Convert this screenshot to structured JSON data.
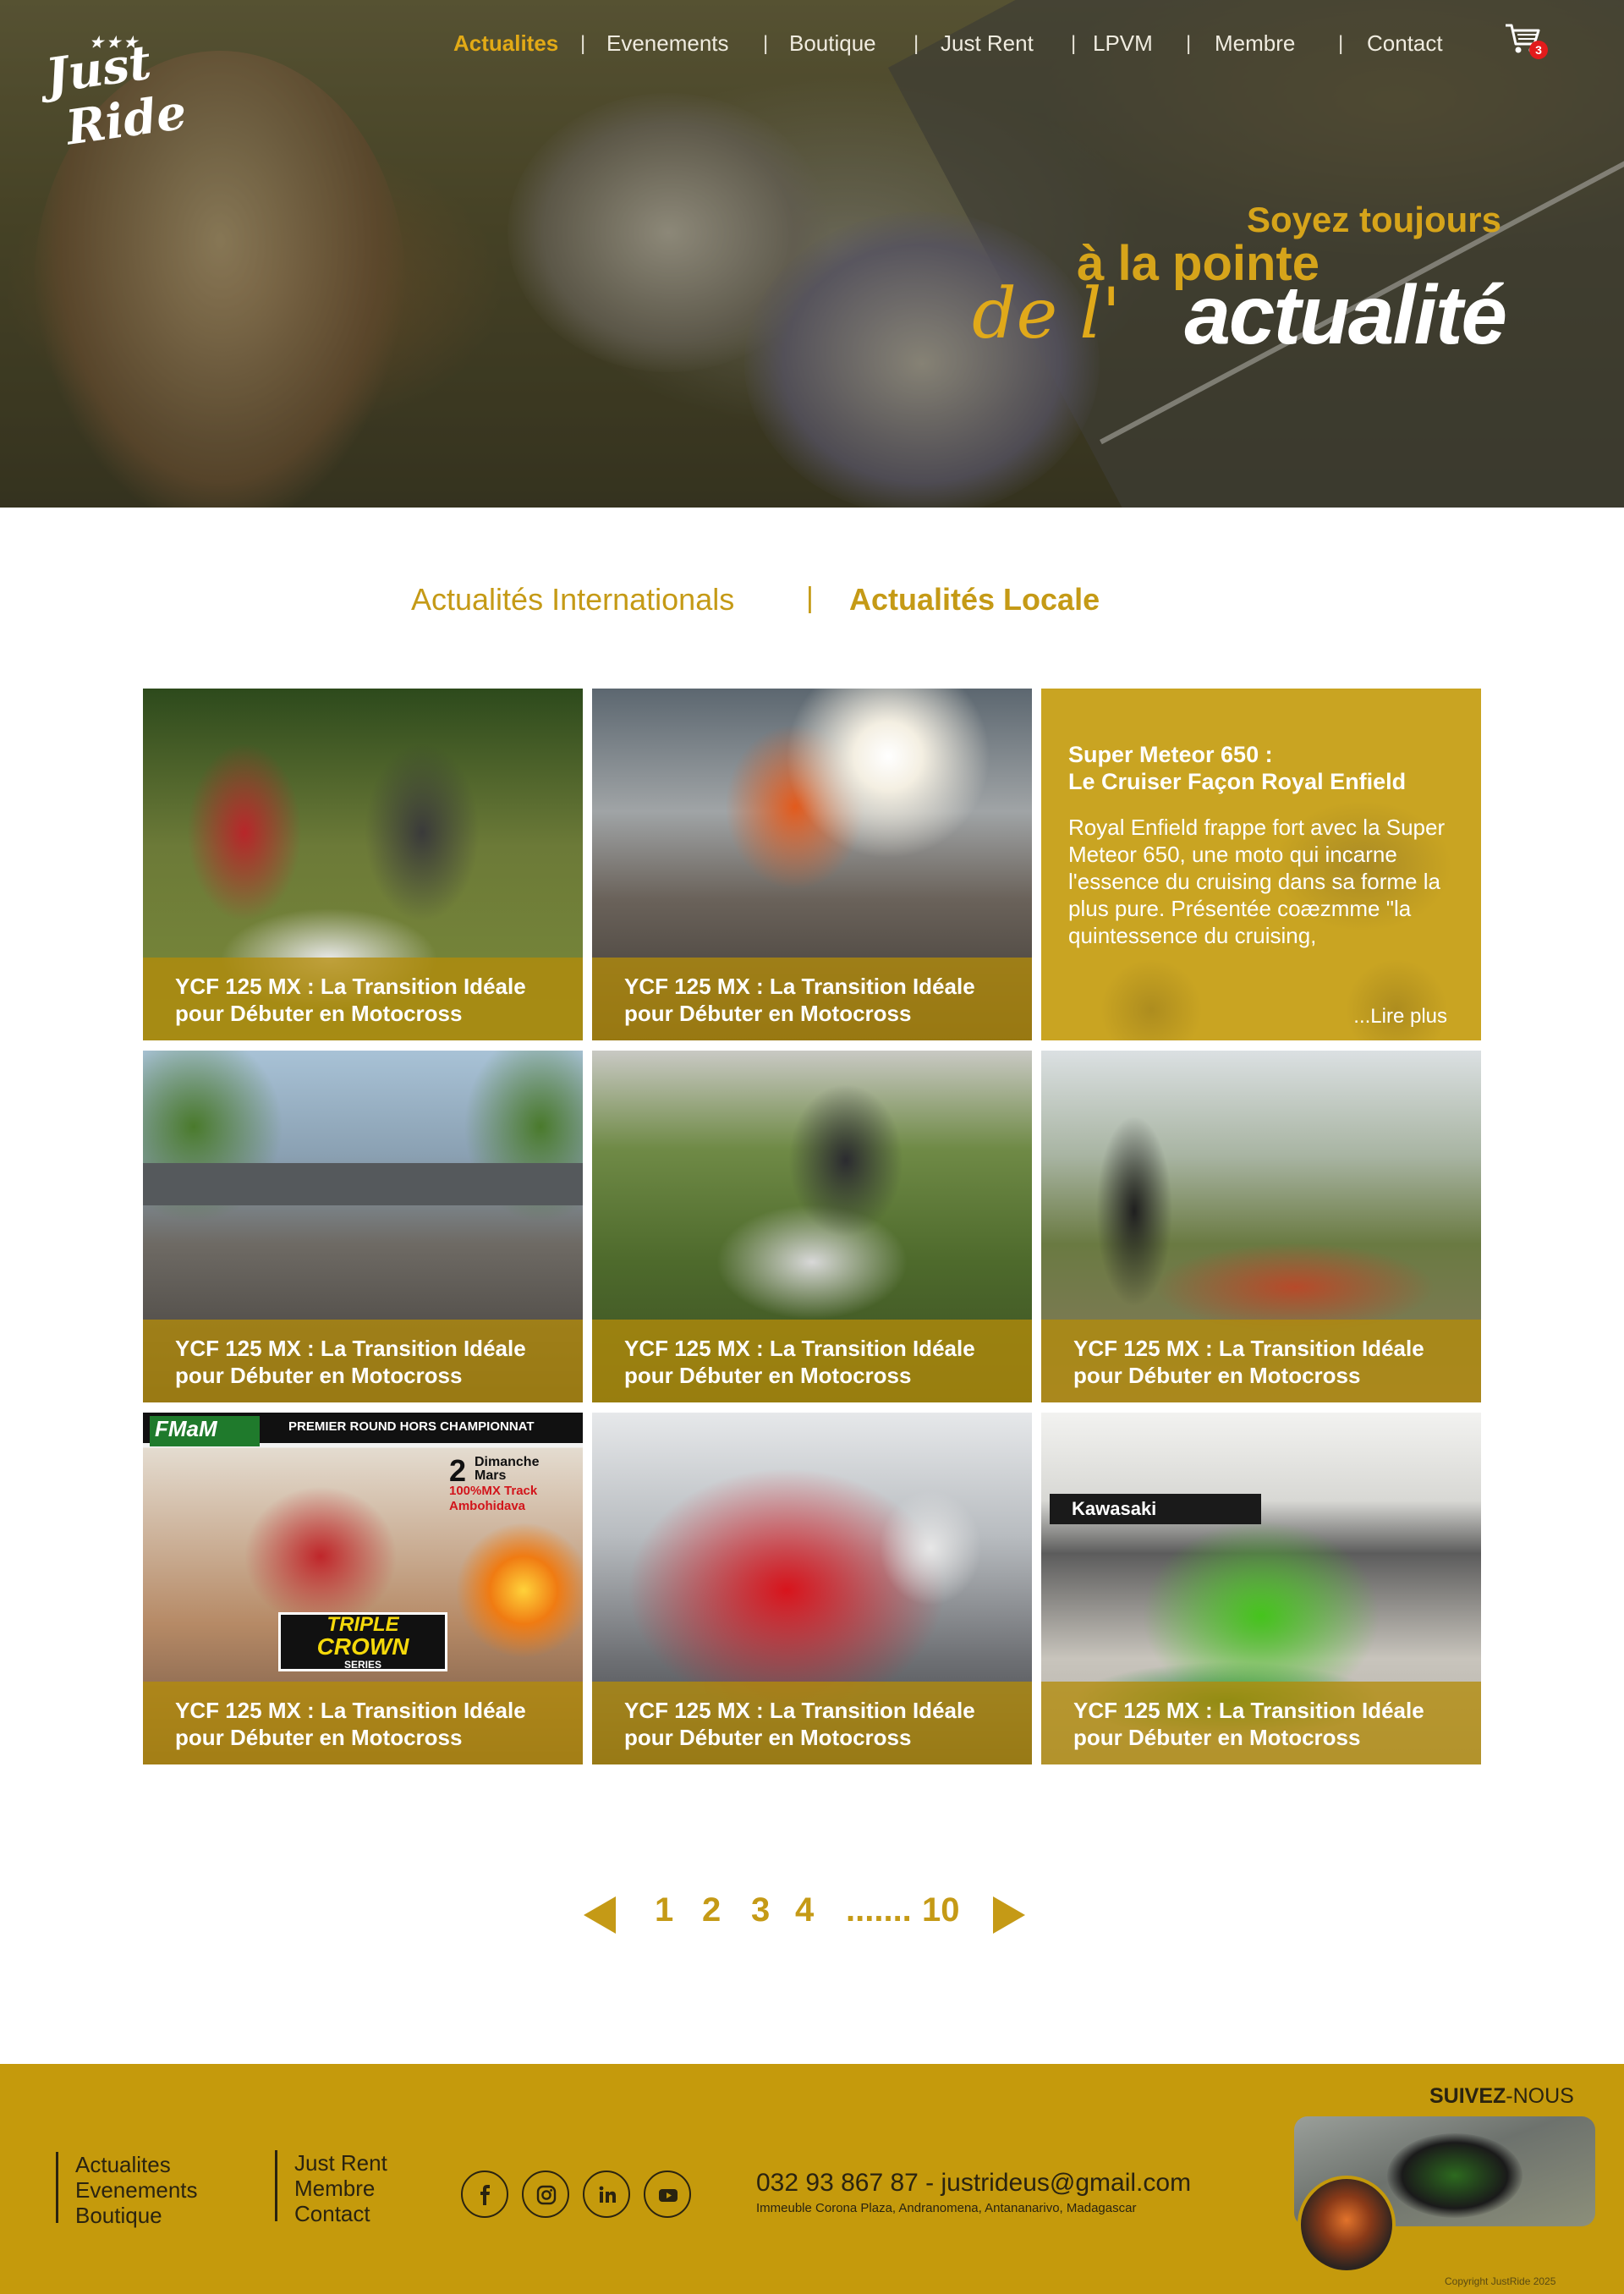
{
  "brand": {
    "logo_text_1": "Just",
    "logo_text_2": "Ride",
    "accent": "#c59a16",
    "footer_bg": "#c59a0c"
  },
  "nav": {
    "items": [
      {
        "label": "Actualites",
        "active": true
      },
      {
        "label": "Evenements",
        "active": false
      },
      {
        "label": "Boutique",
        "active": false
      },
      {
        "label": "Just Rent",
        "active": false
      },
      {
        "label": "LPVM",
        "active": false
      },
      {
        "label": "Membre",
        "active": false
      },
      {
        "label": "Contact",
        "active": false
      }
    ],
    "separator": "|",
    "cart_icon": "cart-icon",
    "cart_count": "3"
  },
  "hero": {
    "line1": "Soyez toujours",
    "line2": "à la pointe",
    "line3": "de l'",
    "line4": "actualité"
  },
  "tabs": {
    "international": "Actualités Internationals",
    "local": "Actualités Locale",
    "separator": "|"
  },
  "articles": [
    {
      "title_1": "YCF 125 MX : La Transition Idéale",
      "title_2": "pour Débuter en Motocross",
      "image": "kids-motocross-photo"
    },
    {
      "title_1": "YCF 125 MX : La Transition Idéale",
      "title_2": "pour Débuter en Motocross",
      "image": "dirtbike-jump-photo"
    },
    {
      "title_1": "YCF 125 MX : La Transition Idéale",
      "title_2": "pour Débuter en Motocross",
      "image": "ducati-store-photo"
    },
    {
      "title_1": "YCF 125 MX : La Transition Idéale",
      "title_2": "pour Débuter en Motocross",
      "image": "enduro-trail-photo"
    },
    {
      "title_1": "YCF 125 MX : La Transition Idéale",
      "title_2": "pour Débuter en Motocross",
      "image": "watering-garden-photo"
    },
    {
      "title_1": "YCF 125 MX : La Transition Idéale",
      "title_2": "pour Débuter en Motocross",
      "image": "triple-crown-poster"
    },
    {
      "title_1": "YCF 125 MX : La Transition Idéale",
      "title_2": "pour Débuter en Motocross",
      "image": "motogp-rider-photo"
    },
    {
      "title_1": "YCF 125 MX : La Transition Idéale",
      "title_2": "pour Débuter en Motocross",
      "image": "kawasaki-showroom-photo"
    }
  ],
  "featured": {
    "title_1": "Super Meteor 650 :",
    "title_2": "Le Cruiser Façon Royal Enfield",
    "body": "Royal Enfield frappe fort avec la Super Meteor 650, une moto qui incarne l'essence du cruising dans sa forme la plus pure. Présentée coæzmme \"la quintessence du cruising,",
    "more": "...Lire plus"
  },
  "poster": {
    "header_left": "FMaM",
    "header_right": "PREMIER ROUND HORS CHAMPIONNAT",
    "date_1": "2",
    "date_2": "Dimanche",
    "date_3": "Mars",
    "track": "100%MX Track",
    "place": "Ambohidava",
    "series_1": "TRIPLE",
    "series_2": "CROWN",
    "series_3": "SERIES"
  },
  "pagination": {
    "pages": [
      "1",
      "2",
      "3",
      "4"
    ],
    "dots": ".......",
    "last": "10"
  },
  "footer": {
    "col1": [
      "Actualites",
      "Evenements",
      "Boutique"
    ],
    "col2": [
      "Just Rent",
      "Membre",
      "Contact"
    ],
    "social": [
      "facebook-icon",
      "instagram-icon",
      "linkedin-icon",
      "youtube-icon"
    ],
    "contact": "032 93 867 87 - justrideus@gmail.com",
    "address": "Immeuble Corona Plaza, Andranomena, Antananarivo, Madagascar",
    "follow_bold": "SUIVEZ",
    "follow_rest": "-NOUS",
    "copyright": "Copyright JustRide 2025"
  }
}
